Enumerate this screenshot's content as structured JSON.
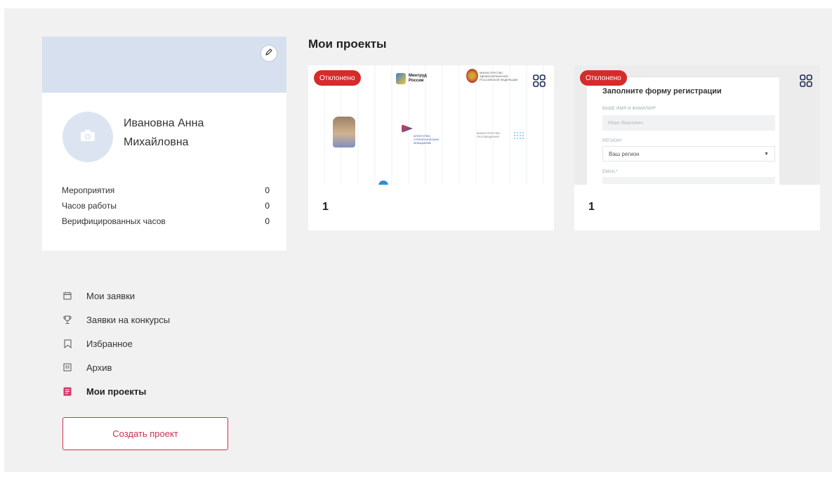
{
  "profile": {
    "name_line1": "Ивановна Анна",
    "name_line2": "Михайловна",
    "stats": [
      {
        "label": "Мероприятия",
        "value": "0"
      },
      {
        "label": "Часов работы",
        "value": "0"
      },
      {
        "label": "Верифицированных часов",
        "value": "0"
      }
    ]
  },
  "menu": {
    "items": [
      {
        "label": "Мои заявки",
        "icon": "calendar-icon"
      },
      {
        "label": "Заявки на конкурсы",
        "icon": "trophy-icon"
      },
      {
        "label": "Избранное",
        "icon": "bookmark-icon"
      },
      {
        "label": "Архив",
        "icon": "archive-icon"
      },
      {
        "label": "Мои проекты",
        "icon": "projects-icon",
        "active": true
      }
    ]
  },
  "create_button": "Создать проект",
  "main": {
    "title": "Мои проекты"
  },
  "projects": [
    {
      "badge": "Отклонено",
      "number": "1",
      "thumb_logos": {
        "mintrud": "Минтруд России",
        "ministry_top": "МИНИСТЕРСТВО ЗДРАВООХРАНЕНИЯ РОССИЙСКОЙ ФЕДЕРАЦИИ",
        "asi": "АГЕНТСТВО СТРАТЕГИЧЕСКИХ ИНИЦИАТИВ",
        "ministry_bottom": "МИНИСТЕРСТВО ПРОСВЕЩЕНИЯ"
      }
    },
    {
      "badge": "Отклонено",
      "number": "1",
      "form": {
        "title": "Заполните форму регистрации",
        "name_label": "ВАШЕ ИМЯ И ФАМИЛИЯ*",
        "name_placeholder": "Иван Иванович",
        "region_label": "РЕГИОН*",
        "region_value": "Ваш регион",
        "email_label": "EMAIL*"
      }
    }
  ],
  "colors": {
    "accent": "#c53250",
    "badge": "#d62b2b",
    "cover": "#d7e0ee",
    "background": "#f1f1f1"
  }
}
